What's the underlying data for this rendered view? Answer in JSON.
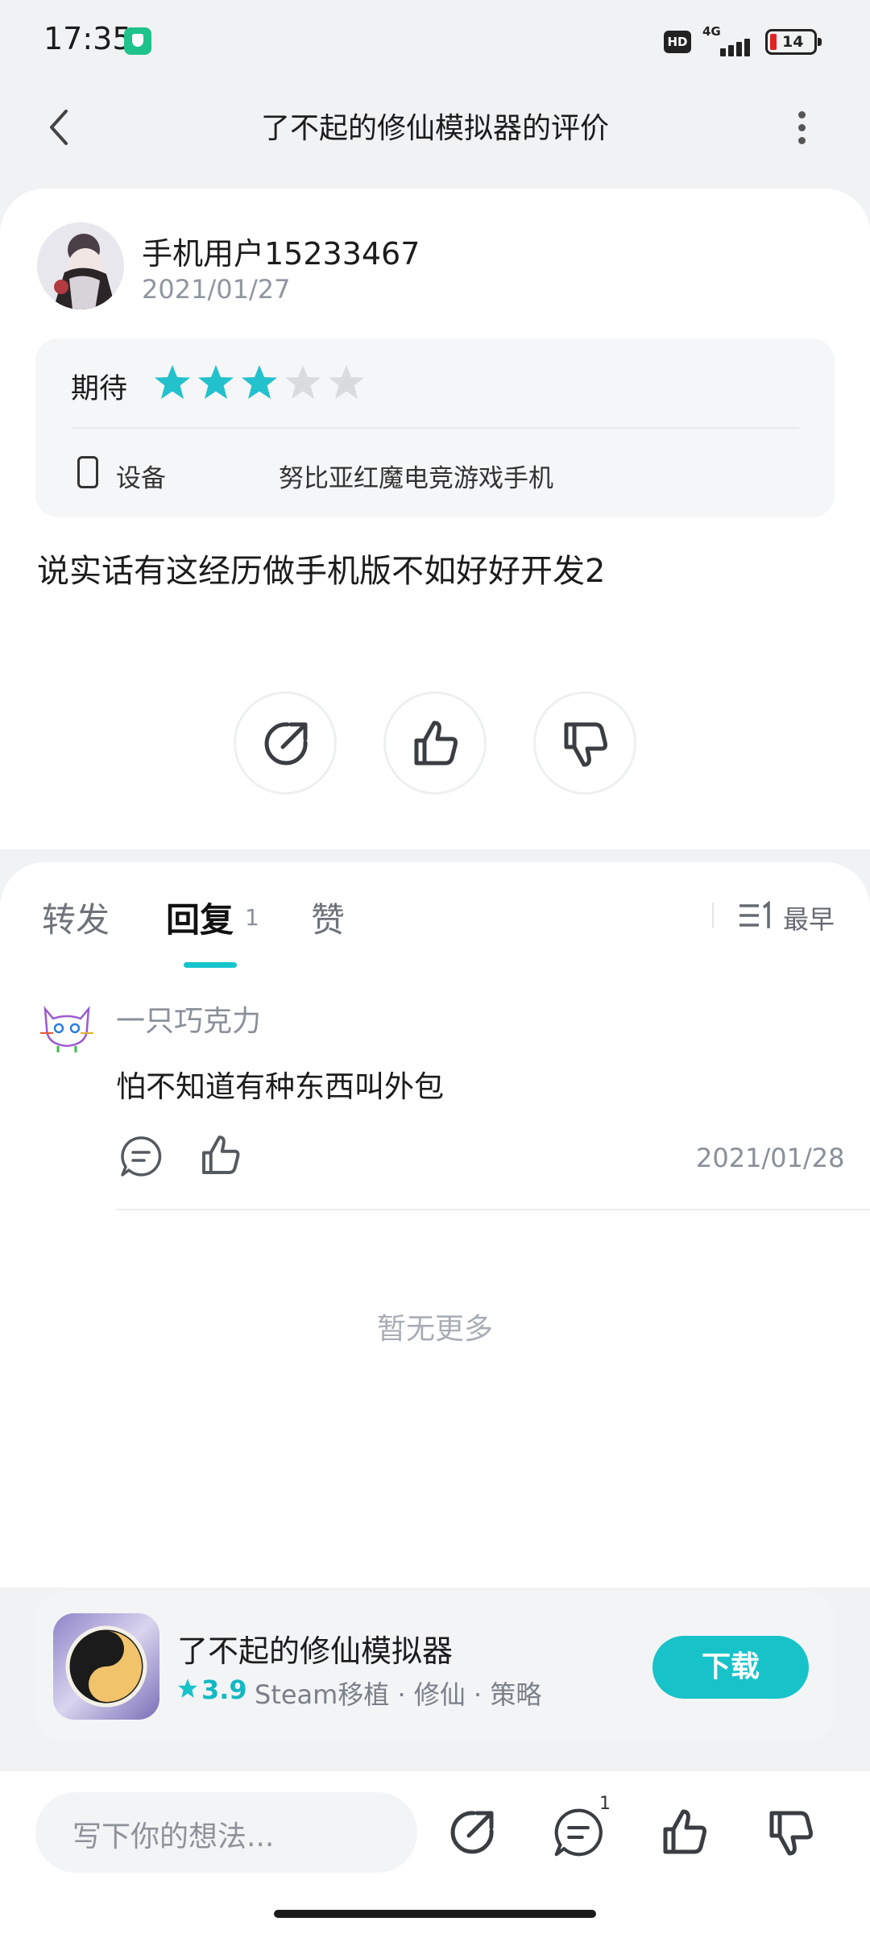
{
  "status_bar": {
    "time": "17:35",
    "network": "4G",
    "hd_badge": "HD",
    "battery": "14",
    "battery_level": 0.14
  },
  "header": {
    "title": "了不起的修仙模拟器的评价",
    "back_icon": "chevron-left-icon",
    "more_icon": "more-vertical-icon"
  },
  "review": {
    "username": "手机用户15233467",
    "date": "2021/01/27",
    "rating_label": "期待",
    "rating": 3,
    "rating_max": 5,
    "device_label": "设备",
    "device_value": "努比亚红魔电竞游戏手机",
    "text": "说实话有这经历做手机版不如好好开发2",
    "actions": [
      "share-icon",
      "thumbs-up-icon",
      "thumbs-down-icon"
    ]
  },
  "tabs": {
    "forward": "转发",
    "reply": "回复",
    "reply_count": "1",
    "like": "赞",
    "sort_label": "最早"
  },
  "replies": [
    {
      "username": "一只巧克力",
      "text": "怕不知道有种东西叫外包",
      "date": "2021/01/28"
    }
  ],
  "no_more": "暂无更多",
  "app": {
    "name": "了不起的修仙模拟器",
    "rating": "3.9",
    "tags": "Steam移植 · 修仙 · 策略",
    "download_label": "下载"
  },
  "bottom_bar": {
    "placeholder": "写下你的想法...",
    "comment_badge": "1"
  },
  "colors": {
    "accent": "#17c3c9",
    "star_on": "#22c1cc",
    "star_off": "#d9dcdf"
  }
}
